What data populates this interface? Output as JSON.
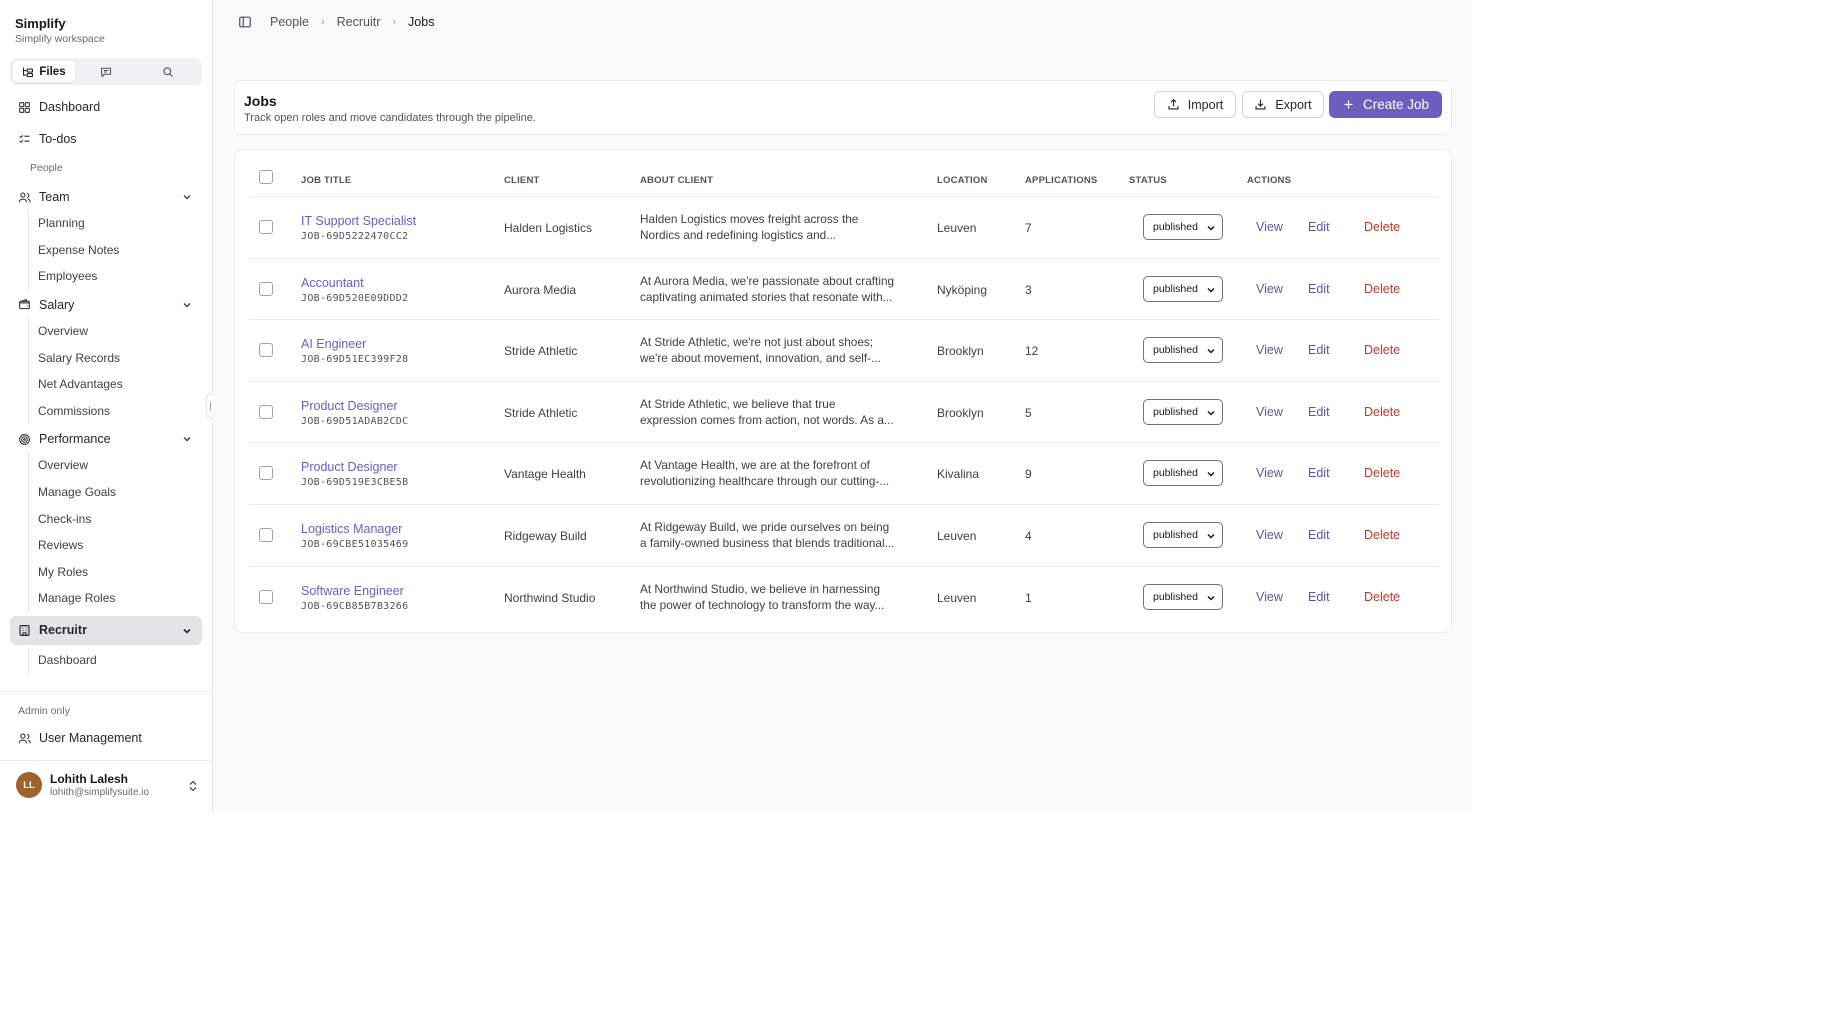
{
  "brand": {
    "name": "Simplify",
    "subtitle": "Simplify workspace"
  },
  "segmented": {
    "files_label": "Files"
  },
  "nav": {
    "dashboard": "Dashboard",
    "todos": "To-dos",
    "group_people": "People",
    "team": {
      "label": "Team",
      "items": [
        "Planning",
        "Expense Notes",
        "Employees"
      ]
    },
    "salary": {
      "label": "Salary",
      "items": [
        "Overview",
        "Salary Records",
        "Net Advantages",
        "Commissions"
      ]
    },
    "performance": {
      "label": "Performance",
      "items": [
        "Overview",
        "Manage Goals",
        "Check-ins",
        "Reviews",
        "My Roles",
        "Manage Roles"
      ]
    },
    "recruitr": {
      "label": "Recruitr",
      "items": [
        "Dashboard"
      ]
    },
    "admin_label": "Admin only",
    "user_management": "User Management"
  },
  "user": {
    "initials": "LL",
    "name": "Lohith Lalesh",
    "email": "lohith@simplifysuite.io"
  },
  "breadcrumb": [
    "People",
    "Recruitr",
    "Jobs"
  ],
  "page": {
    "title": "Jobs",
    "subtitle": "Track open roles and move candidates through the pipeline.",
    "import_label": "Import",
    "export_label": "Export",
    "create_label": "Create Job"
  },
  "table": {
    "headers": {
      "job_title": "JOB TITLE",
      "client": "CLIENT",
      "about": "ABOUT CLIENT",
      "location": "LOCATION",
      "applications": "APPLICATIONS",
      "status": "STATUS",
      "actions": "ACTIONS"
    },
    "action_labels": {
      "view": "View",
      "edit": "Edit",
      "delete": "Delete"
    },
    "rows": [
      {
        "title": "IT Support Specialist",
        "id": "JOB-69D5222470CC2",
        "client": "Halden Logistics",
        "about1": "Halden Logistics moves freight across the",
        "about2": "Nordics and redefining logistics and...",
        "location": "Leuven",
        "applications": "7",
        "status": "published"
      },
      {
        "title": "Accountant",
        "id": "JOB-69D520E09DDD2",
        "client": "Aurora Media",
        "about1": "At Aurora Media, we're passionate about crafting",
        "about2": "captivating animated stories that resonate with...",
        "location": "Nyköping",
        "applications": "3",
        "status": "published"
      },
      {
        "title": "AI Engineer",
        "id": "JOB-69D51EC399F28",
        "client": "Stride Athletic",
        "about1": "At Stride Athletic, we're not just about shoes;",
        "about2": "we're about movement, innovation, and self-...",
        "location": "Brooklyn",
        "applications": "12",
        "status": "published"
      },
      {
        "title": "Product Designer",
        "id": "JOB-69D51ADAB2CDC",
        "client": "Stride Athletic",
        "about1": "At Stride Athletic, we believe that true",
        "about2": "expression comes from action, not words. As a...",
        "location": "Brooklyn",
        "applications": "5",
        "status": "published"
      },
      {
        "title": "Product Designer",
        "id": "JOB-69D519E3CBE5B",
        "client": "Vantage Health",
        "about1": "At Vantage Health, we are at the forefront of",
        "about2": "revolutionizing healthcare through our cutting-...",
        "location": "Kivalina",
        "applications": "9",
        "status": "published"
      },
      {
        "title": "Logistics Manager",
        "id": "JOB-69CBE51035469",
        "client": "Ridgeway Build",
        "about1": "At Ridgeway Build, we pride ourselves on being",
        "about2": "a family-owned business that blends traditional...",
        "location": "Leuven",
        "applications": "4",
        "status": "published"
      },
      {
        "title": "Software Engineer",
        "id": "JOB-69CB85B7B3266",
        "client": "Northwind Studio",
        "about1": "At Northwind Studio, we believe in harnessing",
        "about2": "the power of technology to transform the way...",
        "location": "Leuven",
        "applications": "1",
        "status": "published"
      }
    ]
  },
  "colors": {
    "accent": "#6a5fc1",
    "danger": "#c0392b",
    "avatar": "#a0632c"
  }
}
